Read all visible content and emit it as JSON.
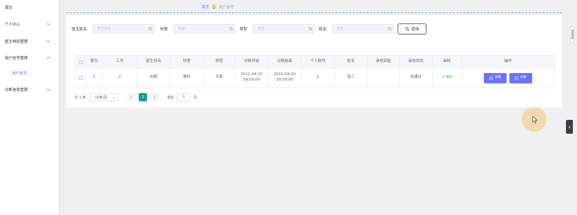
{
  "sidebar": {
    "items": [
      {
        "label": "首页"
      },
      {
        "label": "个人中心"
      },
      {
        "label": "医生排班管理"
      },
      {
        "label": "用户挂号管理"
      },
      {
        "label": "用户挂号"
      },
      {
        "label": "诊断信息管理"
      }
    ]
  },
  "breadcrumb": {
    "home": "首页",
    "current": "用户挂号"
  },
  "search": {
    "doctor_label": "医生姓名",
    "doctor_placeholder": "医生姓名",
    "dept_label": "科室",
    "dept_placeholder": "科室",
    "type_label": "类型",
    "type_placeholder": "类型",
    "name_label": "姓名",
    "name_placeholder": "姓名",
    "query_button": "查询"
  },
  "table": {
    "headers": [
      "索引",
      "工号",
      "医生姓名",
      "科室",
      "类型",
      "诊断开始",
      "诊断结束",
      "个人账号",
      "姓名",
      "审核回复",
      "审核状态",
      "审核",
      "操作"
    ],
    "rows": [
      {
        "index": "1",
        "staff_no": "2",
        "doctor": "刘刚",
        "dept": "骨科",
        "type": "专家",
        "start_date": "2021-04-10",
        "start_time": "09:00:00",
        "end_date": "2021-04-10",
        "end_time": "20:00:00",
        "account": "1",
        "name": "张三",
        "reply": "",
        "status": "未通过",
        "audit": "审核",
        "detail_button": "详情",
        "diagnose_button": "诊断"
      }
    ]
  },
  "pagination": {
    "total": "共 1 条",
    "page_size": "10条/页",
    "current_page": "1",
    "goto_label": "前往",
    "goto_value": "1",
    "page_suffix": "页"
  },
  "colors": {
    "accent": "#5b7cff",
    "button": "#6d73ff",
    "active_page": "#18a08a",
    "audit": "#27ae60"
  }
}
